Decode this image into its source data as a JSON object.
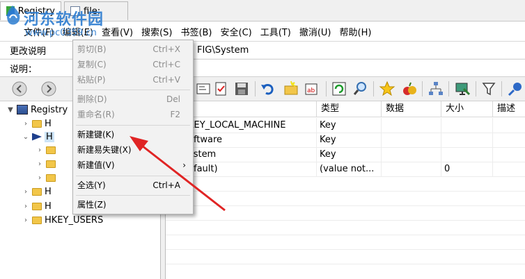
{
  "tabs": [
    {
      "label": "Registry"
    },
    {
      "label": "file:"
    }
  ],
  "watermark": {
    "title": "河东软件园",
    "url": "www.pc0359.cn"
  },
  "menubar": [
    "文件(F)",
    "编辑(E)",
    "查看(V)",
    "搜索(S)",
    "书签(B)",
    "安全(C)",
    "工具(T)",
    "撤消(U)",
    "帮助(H)"
  ],
  "address": {
    "label": "更改说明",
    "path": "FIG\\System"
  },
  "description": {
    "label": "说明："
  },
  "tree": {
    "root": "Registry",
    "nodes": [
      "H",
      "H",
      "H",
      "H",
      "HKEY_USERS"
    ]
  },
  "list": {
    "columns": [
      "",
      "类型",
      "数据",
      "大小",
      "描述"
    ],
    "rows": [
      [
        "KEY_LOCAL_MACHINE",
        "Key",
        "",
        ""
      ],
      [
        "oftware",
        "Key",
        "",
        ""
      ],
      [
        "ystem",
        "Key",
        "",
        ""
      ],
      [
        "efault)",
        "(value not...",
        "",
        "0"
      ]
    ]
  },
  "context_menu": {
    "items": [
      {
        "label": "剪切(B)",
        "shortcut": "Ctrl+X",
        "enabled": false
      },
      {
        "label": "复制(C)",
        "shortcut": "Ctrl+C",
        "enabled": false
      },
      {
        "label": "粘贴(P)",
        "shortcut": "Ctrl+V",
        "enabled": false
      },
      {
        "label": "删除(D)",
        "shortcut": "Del",
        "enabled": false
      },
      {
        "label": "重命名(R)",
        "shortcut": "F2",
        "enabled": false
      },
      {
        "label": "新建键(K)",
        "shortcut": "",
        "enabled": true
      },
      {
        "label": "新建易失键(X)",
        "shortcut": "",
        "enabled": true
      },
      {
        "label": "新建值(V)",
        "shortcut": "›",
        "enabled": true
      },
      {
        "label": "全选(Y)",
        "shortcut": "Ctrl+A",
        "enabled": true
      },
      {
        "label": "属性(Z)",
        "shortcut": "",
        "enabled": true
      }
    ]
  },
  "colors": {
    "accent": "#2c7cd0",
    "arrow": "#e02424",
    "folder": "#f2c649"
  }
}
